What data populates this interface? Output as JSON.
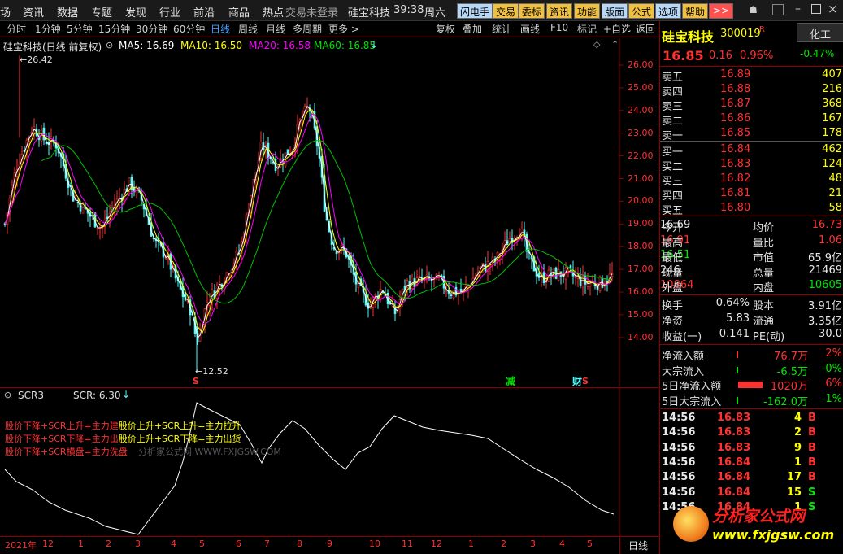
{
  "menu": {
    "items": [
      "场",
      "资讯",
      "数据",
      "专题",
      "发现",
      "行业",
      "前沿",
      "商品",
      "热点"
    ],
    "login_status": "交易未登录",
    "ticker_scroll": "硅宝科技",
    "clock": "39:38",
    "weekday": "周六",
    "buttons": [
      "闪电手",
      "交易",
      "委标",
      "资讯",
      "功能",
      "版面",
      "公式",
      "选项",
      "帮助"
    ],
    "more": ">>"
  },
  "periods": {
    "items": [
      "分时",
      "1分钟",
      "5分钟",
      "15分钟",
      "30分钟",
      "60分钟",
      "日线",
      "周线",
      "月线",
      "多周期",
      "更多 >"
    ],
    "active_index": 6,
    "right_items": [
      "复权",
      "叠加",
      "统计",
      "画线",
      "F10",
      "标记",
      "+自选",
      "返回"
    ]
  },
  "main_chart": {
    "title": "硅宝科技(日线 前复权)",
    "ma5": "MA5: 16.69",
    "ma10": "MA10: 16.50",
    "ma20": "MA20: 16.58",
    "ma60": "MA60: 16.85",
    "high_label": "26.42",
    "low_label": "12.52",
    "marker_s": "S",
    "marker_jian": "减",
    "marker_cai": "财",
    "y_ticks": [
      "26.00",
      "25.00",
      "24.00",
      "23.00",
      "22.00",
      "21.00",
      "20.00",
      "19.00",
      "18.00",
      "17.00",
      "16.00",
      "15.00",
      "14.00"
    ],
    "colors": {
      "ma5": "#ffffff",
      "ma10": "#ffff00",
      "ma20": "#ff00ff",
      "ma60": "#00c000",
      "up": "#ff3232",
      "down": "#54fcfc"
    }
  },
  "indicator": {
    "name": "SCR3",
    "value": "SCR: 6.30",
    "notes": [
      {
        "text": "股价下降+SCR上升=主力建",
        "color": "#ff3232"
      },
      {
        "text": "股价上升+SCR上升=主力拉升",
        "color": "#ffff00"
      },
      {
        "text": "股价下降+SCR下降=主力出",
        "color": "#ff3232"
      },
      {
        "text": "股价上升+SCR下降=主力出货",
        "color": "#ffff00"
      },
      {
        "text": "股价下降+SCR横盘=主力洗盘",
        "color": "#ff3232"
      }
    ],
    "watermark": "分析家公式网 WWW.FXJGSW.COM"
  },
  "time_axis": {
    "labels": [
      "2021年",
      "12",
      "1",
      "2",
      "3",
      "4",
      "5",
      "6",
      "7",
      "8",
      "9",
      "10",
      "11",
      "12",
      "1",
      "2",
      "3",
      "4",
      "5"
    ],
    "period_label": "日线"
  },
  "quote": {
    "name": "硅宝科技",
    "code": "300019",
    "flag": "R",
    "tab": "化工",
    "price": "16.85",
    "change": "0.16",
    "pct": "0.96%",
    "sector_pct": "-0.47%",
    "asks": [
      {
        "label": "卖五",
        "price": "16.89",
        "vol": "407"
      },
      {
        "label": "卖四",
        "price": "16.88",
        "vol": "216"
      },
      {
        "label": "卖三",
        "price": "16.87",
        "vol": "368"
      },
      {
        "label": "卖二",
        "price": "16.86",
        "vol": "167"
      },
      {
        "label": "卖一",
        "price": "16.85",
        "vol": "178"
      }
    ],
    "bids": [
      {
        "label": "买一",
        "price": "16.84",
        "vol": "462"
      },
      {
        "label": "买二",
        "price": "16.83",
        "vol": "124"
      },
      {
        "label": "买三",
        "price": "16.82",
        "vol": "48"
      },
      {
        "label": "买四",
        "price": "16.81",
        "vol": "21"
      },
      {
        "label": "买五",
        "price": "16.80",
        "vol": "58"
      }
    ],
    "stats": [
      {
        "l1": "今开",
        "v1": "16.69",
        "c1": "wht",
        "l2": "均价",
        "v2": "16.73",
        "c2": "red"
      },
      {
        "l1": "最高",
        "v1": "16.91",
        "c1": "red",
        "l2": "量比",
        "v2": "1.06",
        "c2": "red"
      },
      {
        "l1": "最低",
        "v1": "16.51",
        "c1": "grn",
        "l2": "市值",
        "v2": "65.9亿",
        "c2": "wht"
      },
      {
        "l1": "现量",
        "v1": "246",
        "c1": "wht",
        "l2": "总量",
        "v2": "21469",
        "c2": "wht"
      },
      {
        "l1": "外盘",
        "v1": "10864",
        "c1": "red",
        "l2": "内盘",
        "v2": "10605",
        "c2": "grn"
      }
    ],
    "stats2": [
      {
        "l1": "换手",
        "v1": "0.64%",
        "l2": "股本",
        "v2": "3.91亿"
      },
      {
        "l1": "净资",
        "v1": "5.83",
        "l2": "流通",
        "v2": "3.35亿"
      },
      {
        "l1": "收益(一)",
        "v1": "0.141",
        "l2": "PE(动)",
        "v2": "30.0"
      }
    ],
    "flows": [
      {
        "label": "净流入额",
        "value": "76.7万",
        "pct": "2%",
        "color": "red"
      },
      {
        "label": "大宗流入",
        "value": "-6.5万",
        "pct": "-0%",
        "color": "grn"
      },
      {
        "label": "5日净流入额",
        "value": "1020万",
        "pct": "6%",
        "color": "red"
      },
      {
        "label": "5日大宗流入",
        "value": "-162.0万",
        "pct": "-1%",
        "color": "grn"
      }
    ],
    "ticks": [
      {
        "t": "14:56",
        "p": "16.83",
        "v": "4",
        "s": "B"
      },
      {
        "t": "14:56",
        "p": "16.83",
        "v": "2",
        "s": "B"
      },
      {
        "t": "14:56",
        "p": "16.83",
        "v": "9",
        "s": "B"
      },
      {
        "t": "14:56",
        "p": "16.84",
        "v": "1",
        "s": "B"
      },
      {
        "t": "14:56",
        "p": "16.84",
        "v": "17",
        "s": "B"
      },
      {
        "t": "14:56",
        "p": "16.84",
        "v": "15",
        "s": "S"
      },
      {
        "t": "14:56",
        "p": "16.84",
        "v": "1",
        "s": "S"
      }
    ],
    "logo_text": "分析家公式网",
    "logo_url": "www.fxjgsw.com"
  }
}
